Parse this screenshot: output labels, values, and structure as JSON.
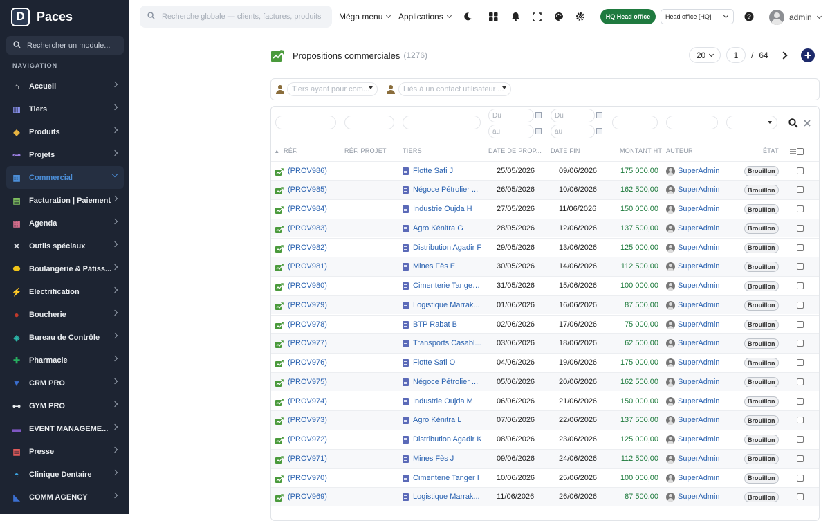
{
  "brand": {
    "logo": "D",
    "name": "Paces"
  },
  "sidebar": {
    "search_placeholder": "Rechercher un module...",
    "nav_title": "NAVIGATION",
    "items": [
      {
        "label": "Accueil",
        "icon": "home-icon",
        "color": "#ffffff",
        "glyph": "⌂"
      },
      {
        "label": "Tiers",
        "icon": "building-icon",
        "color": "#8b93f0",
        "glyph": "▥"
      },
      {
        "label": "Produits",
        "icon": "box-icon",
        "color": "#e6b341",
        "glyph": "◆"
      },
      {
        "label": "Projets",
        "icon": "sitemap-icon",
        "color": "#9b7fe0",
        "glyph": "⊶"
      },
      {
        "label": "Commercial",
        "icon": "briefcase-icon",
        "color": "#4c8fd9",
        "glyph": "▦",
        "active": true
      },
      {
        "label": "Facturation | Paiement",
        "icon": "invoice-icon",
        "color": "#7fbf5f",
        "glyph": "▤"
      },
      {
        "label": "Agenda",
        "icon": "calendar-icon",
        "color": "#d96f8e",
        "glyph": "▦"
      },
      {
        "label": "Outils spéciaux",
        "icon": "tools-icon",
        "color": "#d5d8de",
        "glyph": "✕"
      },
      {
        "label": "Boulangerie & Pâtiss...",
        "icon": "bread-icon",
        "color": "#f0c419",
        "glyph": "⬬"
      },
      {
        "label": "Electrification",
        "icon": "bolt-icon",
        "color": "#f5c518",
        "glyph": "⚡"
      },
      {
        "label": "Boucherie",
        "icon": "meat-icon",
        "color": "#c0392b",
        "glyph": "●"
      },
      {
        "label": "Bureau de Contrôle",
        "icon": "shield-icon",
        "color": "#2bb5a8",
        "glyph": "◈"
      },
      {
        "label": "Pharmacie",
        "icon": "cross-icon",
        "color": "#27ae60",
        "glyph": "✚"
      },
      {
        "label": "CRM PRO",
        "icon": "funnel-icon",
        "color": "#3b6fd1",
        "glyph": "▼"
      },
      {
        "label": "GYM PRO",
        "icon": "dumbbell-icon",
        "color": "#e9ecef",
        "glyph": "⊷"
      },
      {
        "label": "EVENT MANAGEME...",
        "icon": "ticket-icon",
        "color": "#7e57c2",
        "glyph": "▬"
      },
      {
        "label": "Presse",
        "icon": "newspaper-icon",
        "color": "#e05a5a",
        "glyph": "▤"
      },
      {
        "label": "Clinique Dentaire",
        "icon": "tooth-icon",
        "color": "#3ba3e0",
        "glyph": "◓"
      },
      {
        "label": "COMM AGENCY",
        "icon": "megaphone-icon",
        "color": "#3b6fd1",
        "glyph": "◣"
      }
    ]
  },
  "topbar": {
    "search_placeholder": "Recherche globale — clients, factures, produits...",
    "mega_menu": "Méga menu",
    "applications": "Applications",
    "hq_button": "HQ Head office",
    "entity_select": "Head office [HQ]",
    "user": "admin"
  },
  "page": {
    "title": "Propositions commerciales",
    "count": "(1276)",
    "per_page": "20",
    "current_page": "1",
    "separator": "/",
    "total_pages": "64",
    "add_glyph": "+"
  },
  "filters": {
    "tiers_placeholder": "Tiers ayant pour com...",
    "contact_placeholder": "Liés à un contact utilisateur ...",
    "date_from": "Du",
    "date_to": "au"
  },
  "table": {
    "headers": {
      "ref": "RÉF.",
      "ref_projet": "RÉF. PROJET",
      "tiers": "TIERS",
      "date_prop": "DATE DE PROP...",
      "date_fin": "DATE FIN",
      "montant": "MONTANT HT",
      "auteur": "AUTEUR",
      "etat": "ÉTAT"
    },
    "rows": [
      {
        "ref": "(PROV986)",
        "tiers": "Flotte Safi J",
        "date_prop": "25/05/2026",
        "date_fin": "09/06/2026",
        "montant": "175 000,00",
        "auteur": "SuperAdmin",
        "etat": "Brouillon"
      },
      {
        "ref": "(PROV985)",
        "tiers": "Négoce Pétrolier ...",
        "date_prop": "26/05/2026",
        "date_fin": "10/06/2026",
        "montant": "162 500,00",
        "auteur": "SuperAdmin",
        "etat": "Brouillon"
      },
      {
        "ref": "(PROV984)",
        "tiers": "Industrie Oujda H",
        "date_prop": "27/05/2026",
        "date_fin": "11/06/2026",
        "montant": "150 000,00",
        "auteur": "SuperAdmin",
        "etat": "Brouillon"
      },
      {
        "ref": "(PROV983)",
        "tiers": "Agro Kénitra G",
        "date_prop": "28/05/2026",
        "date_fin": "12/06/2026",
        "montant": "137 500,00",
        "auteur": "SuperAdmin",
        "etat": "Brouillon"
      },
      {
        "ref": "(PROV982)",
        "tiers": "Distribution Agadir F",
        "date_prop": "29/05/2026",
        "date_fin": "13/06/2026",
        "montant": "125 000,00",
        "auteur": "SuperAdmin",
        "etat": "Brouillon"
      },
      {
        "ref": "(PROV981)",
        "tiers": "Mines Fès E",
        "date_prop": "30/05/2026",
        "date_fin": "14/06/2026",
        "montant": "112 500,00",
        "auteur": "SuperAdmin",
        "etat": "Brouillon"
      },
      {
        "ref": "(PROV980)",
        "tiers": "Cimenterie Tanger D",
        "date_prop": "31/05/2026",
        "date_fin": "15/06/2026",
        "montant": "100 000,00",
        "auteur": "SuperAdmin",
        "etat": "Brouillon"
      },
      {
        "ref": "(PROV979)",
        "tiers": "Logistique Marrak...",
        "date_prop": "01/06/2026",
        "date_fin": "16/06/2026",
        "montant": "87 500,00",
        "auteur": "SuperAdmin",
        "etat": "Brouillon"
      },
      {
        "ref": "(PROV978)",
        "tiers": "BTP Rabat B",
        "date_prop": "02/06/2026",
        "date_fin": "17/06/2026",
        "montant": "75 000,00",
        "auteur": "SuperAdmin",
        "etat": "Brouillon"
      },
      {
        "ref": "(PROV977)",
        "tiers": "Transports Casabl...",
        "date_prop": "03/06/2026",
        "date_fin": "18/06/2026",
        "montant": "62 500,00",
        "auteur": "SuperAdmin",
        "etat": "Brouillon"
      },
      {
        "ref": "(PROV976)",
        "tiers": "Flotte Safi O",
        "date_prop": "04/06/2026",
        "date_fin": "19/06/2026",
        "montant": "175 000,00",
        "auteur": "SuperAdmin",
        "etat": "Brouillon"
      },
      {
        "ref": "(PROV975)",
        "tiers": "Négoce Pétrolier ...",
        "date_prop": "05/06/2026",
        "date_fin": "20/06/2026",
        "montant": "162 500,00",
        "auteur": "SuperAdmin",
        "etat": "Brouillon"
      },
      {
        "ref": "(PROV974)",
        "tiers": "Industrie Oujda M",
        "date_prop": "06/06/2026",
        "date_fin": "21/06/2026",
        "montant": "150 000,00",
        "auteur": "SuperAdmin",
        "etat": "Brouillon"
      },
      {
        "ref": "(PROV973)",
        "tiers": "Agro Kénitra L",
        "date_prop": "07/06/2026",
        "date_fin": "22/06/2026",
        "montant": "137 500,00",
        "auteur": "SuperAdmin",
        "etat": "Brouillon"
      },
      {
        "ref": "(PROV972)",
        "tiers": "Distribution Agadir K",
        "date_prop": "08/06/2026",
        "date_fin": "23/06/2026",
        "montant": "125 000,00",
        "auteur": "SuperAdmin",
        "etat": "Brouillon"
      },
      {
        "ref": "(PROV971)",
        "tiers": "Mines Fès J",
        "date_prop": "09/06/2026",
        "date_fin": "24/06/2026",
        "montant": "112 500,00",
        "auteur": "SuperAdmin",
        "etat": "Brouillon"
      },
      {
        "ref": "(PROV970)",
        "tiers": "Cimenterie Tanger I",
        "date_prop": "10/06/2026",
        "date_fin": "25/06/2026",
        "montant": "100 000,00",
        "auteur": "SuperAdmin",
        "etat": "Brouillon"
      },
      {
        "ref": "(PROV969)",
        "tiers": "Logistique Marrak...",
        "date_prop": "11/06/2026",
        "date_fin": "26/06/2026",
        "montant": "87 500,00",
        "auteur": "SuperAdmin",
        "etat": "Brouillon"
      }
    ]
  }
}
